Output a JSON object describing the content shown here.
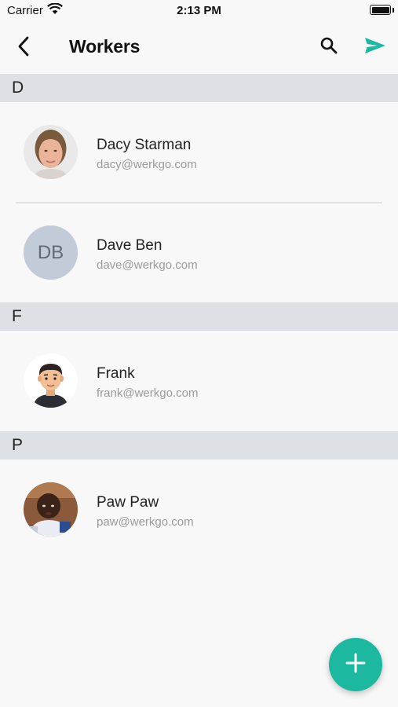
{
  "status_bar": {
    "carrier": "Carrier",
    "time": "2:13 PM"
  },
  "nav": {
    "title": "Workers",
    "back_icon": "chevron-left-icon",
    "search_icon": "search-icon",
    "send_icon": "send-icon"
  },
  "sections": [
    {
      "letter": "D",
      "workers": [
        {
          "name": "Dacy Starman",
          "email": "dacy@werkgo.com",
          "avatar": "photo"
        },
        {
          "name": "Dave Ben",
          "email": "dave@werkgo.com",
          "avatar": "initials",
          "initials": "DB"
        }
      ]
    },
    {
      "letter": "F",
      "workers": [
        {
          "name": "Frank",
          "email": "frank@werkgo.com",
          "avatar": "cartoon"
        }
      ]
    },
    {
      "letter": "P",
      "workers": [
        {
          "name": "Paw Paw",
          "email": "paw@werkgo.com",
          "avatar": "photo"
        }
      ]
    }
  ],
  "fab": {
    "icon": "plus-icon"
  },
  "colors": {
    "accent": "#1cb8a0",
    "section_bg": "#dde1e5",
    "background": "#f8f8f9",
    "email_text": "#9a9a9a",
    "initials_bg": "#c2cbd8"
  }
}
